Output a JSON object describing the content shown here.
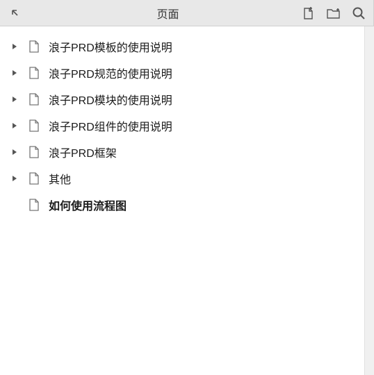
{
  "header": {
    "title": "页面",
    "icons": {
      "collapse": "collapse-panel-icon",
      "new_page": "new-page-icon",
      "new_folder": "new-folder-icon",
      "search": "search-icon"
    }
  },
  "tree": {
    "items": [
      {
        "label": "浪子PRD模板的使用说明",
        "expandable": true,
        "selected": false
      },
      {
        "label": "浪子PRD规范的使用说明",
        "expandable": true,
        "selected": false
      },
      {
        "label": "浪子PRD模块的使用说明",
        "expandable": true,
        "selected": false
      },
      {
        "label": "浪子PRD组件的使用说明",
        "expandable": true,
        "selected": false
      },
      {
        "label": "浪子PRD框架",
        "expandable": true,
        "selected": false
      },
      {
        "label": "其他",
        "expandable": true,
        "selected": false
      },
      {
        "label": "如何使用流程图",
        "expandable": false,
        "selected": true
      }
    ]
  }
}
